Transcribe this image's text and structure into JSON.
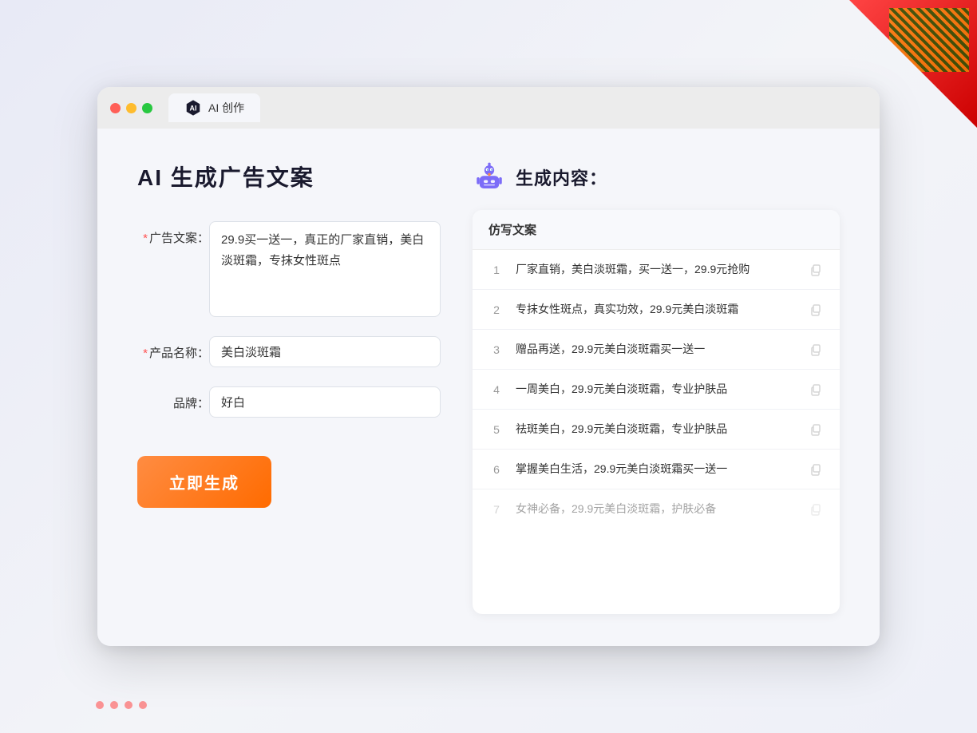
{
  "window": {
    "tab_label": "AI 创作"
  },
  "page": {
    "title": "AI 生成广告文案",
    "right_title": "生成内容："
  },
  "form": {
    "ad_copy_label": "广告文案：",
    "ad_copy_required": true,
    "ad_copy_value": "29.9买一送一，真正的厂家直销，美白淡斑霜，专抹女性斑点",
    "product_name_label": "产品名称：",
    "product_name_required": true,
    "product_name_value": "美白淡斑霜",
    "brand_label": "品牌：",
    "brand_required": false,
    "brand_value": "好白",
    "generate_btn": "立即生成"
  },
  "results": {
    "header": "仿写文案",
    "items": [
      {
        "num": "1",
        "text": "厂家直销，美白淡斑霜，买一送一，29.9元抢购",
        "dimmed": false
      },
      {
        "num": "2",
        "text": "专抹女性斑点，真实功效，29.9元美白淡斑霜",
        "dimmed": false
      },
      {
        "num": "3",
        "text": "赠品再送，29.9元美白淡斑霜买一送一",
        "dimmed": false
      },
      {
        "num": "4",
        "text": "一周美白，29.9元美白淡斑霜，专业护肤品",
        "dimmed": false
      },
      {
        "num": "5",
        "text": "祛斑美白，29.9元美白淡斑霜，专业护肤品",
        "dimmed": false
      },
      {
        "num": "6",
        "text": "掌握美白生活，29.9元美白淡斑霜买一送一",
        "dimmed": false
      },
      {
        "num": "7",
        "text": "女神必备，29.9元美白淡斑霜，护肤必备",
        "dimmed": true
      }
    ]
  }
}
